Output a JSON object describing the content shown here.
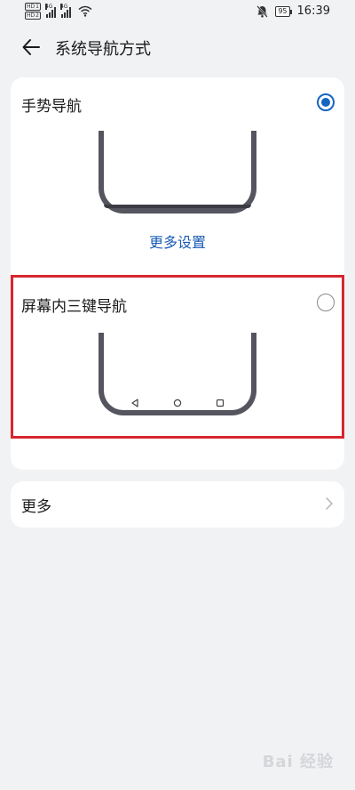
{
  "status_bar": {
    "hd1": "HD",
    "hd2": "HD",
    "net1": "4G",
    "net2": "4G",
    "battery": "95",
    "time": "16:39",
    "icons": [
      "signal-icon",
      "wifi-icon",
      "mute-icon",
      "battery-icon"
    ]
  },
  "header": {
    "title": "系统导航方式",
    "back_icon": "arrow-left-icon"
  },
  "nav_options": {
    "gesture": {
      "label": "手势导航",
      "selected": true,
      "more_settings": "更多设置"
    },
    "three_key": {
      "label": "屏幕内三键导航",
      "selected": false,
      "keys": [
        "back-triangle-icon",
        "home-circle-icon",
        "recent-square-icon"
      ]
    }
  },
  "more": {
    "label": "更多"
  },
  "watermark": "Bai 经验",
  "colors": {
    "accent": "#1565c0",
    "link": "#1a5bb5",
    "highlight_box": "#d7262f",
    "background": "#f1f2f4",
    "card": "#ffffff"
  }
}
